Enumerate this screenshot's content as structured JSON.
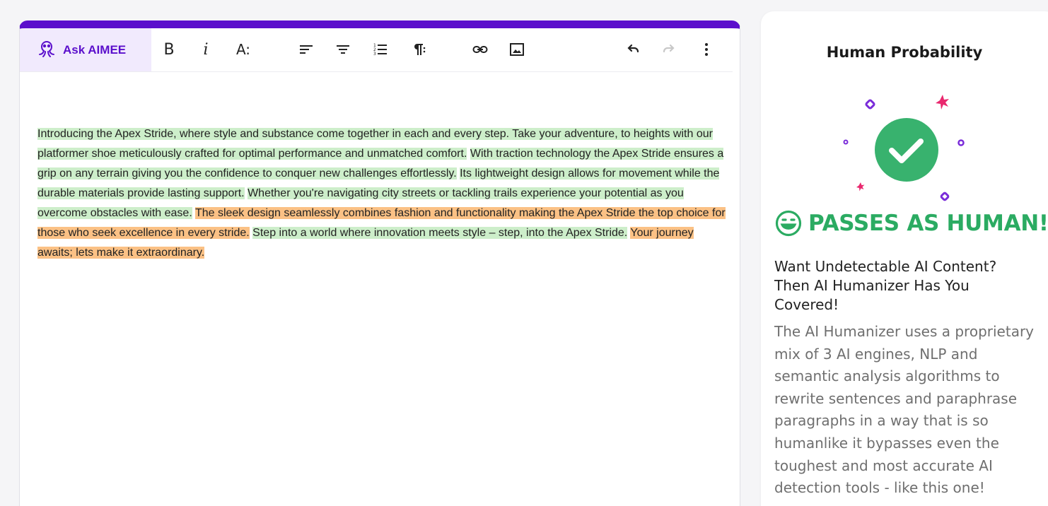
{
  "colors": {
    "brand": "#5b0fcc",
    "human_green": "#2bab62",
    "highlight_green": "#cdeeca",
    "highlight_orange": "#fbc185"
  },
  "toolbar": {
    "ask_label": "Ask AIMEE",
    "bold_glyph": "B",
    "italic_glyph": "i",
    "font_size_glyph": "A:",
    "icons": [
      "octopus-icon",
      "bold-icon",
      "italic-icon",
      "font-size-icon",
      "align-left-icon",
      "align-center-icon",
      "numbered-list-icon",
      "paragraph-icon",
      "link-icon",
      "image-icon",
      "undo-icon",
      "redo-icon",
      "more-vert-icon"
    ]
  },
  "document": {
    "segments": [
      {
        "text": "Introducing the Apex Stride, where style and substance come together in each and every step. Take your adventure, to heights with our platformer shoe meticulously crafted for optimal performance and unmatched comfort.",
        "level": "green"
      },
      {
        "text": "With traction technology the Apex Stride ensures a grip on any terrain giving you the confidence to conquer new challenges effortlessly.",
        "level": "green"
      },
      {
        "text": "Its lightweight design allows for movement while the durable materials provide lasting support.",
        "level": "green"
      },
      {
        "text": "Whether you're navigating city streets or tackling trails experience your potential as you overcome obstacles with ease.",
        "level": "green"
      },
      {
        "text": "The sleek design seamlessly combines fashion and functionality making the Apex Stride the top choice for those who seek excellence in every stride.",
        "level": "orange"
      },
      {
        "text": "Step into a world where innovation meets style – step, into the Apex Stride.",
        "level": "green"
      },
      {
        "text": "Your journey awaits; lets make it extraordinary.",
        "level": "orange"
      }
    ]
  },
  "result": {
    "title": "Human Probability",
    "verdict": "PASSES AS HUMAN!",
    "icons": [
      "check-circle-icon",
      "smile-icon"
    ]
  },
  "promo": {
    "heading": "Want Undetectable AI Content? Then AI Humanizer Has You Covered!",
    "body": "The AI Humanizer uses a proprietary mix of 3 AI engines, NLP and semantic analysis algorithms to rewrite sentences and paraphrase paragraphs in a way that is so humanlike it bypasses even the toughest and most accurate AI detection tools - like this one!"
  }
}
